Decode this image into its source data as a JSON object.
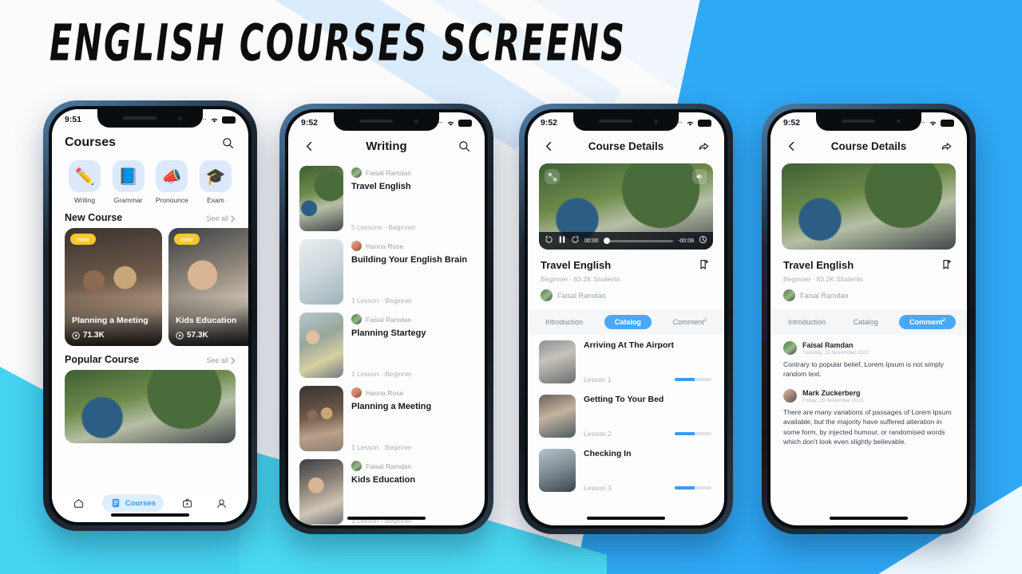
{
  "poster": {
    "title": "ENGLISH COURSES SCREENS"
  },
  "colors": {
    "accent": "#3a9bf0",
    "badge": "#ffc628",
    "bg_blue": "#2fa8f5",
    "bg_cyan": "#4ad9f3"
  },
  "screen1": {
    "status": {
      "time": "9:51"
    },
    "header": {
      "title": "Courses",
      "search_icon": "search-icon"
    },
    "categories": [
      {
        "label": "Writing",
        "icon": "pencil-icon",
        "glyph": "✏️"
      },
      {
        "label": "Grammar",
        "icon": "book-icon",
        "glyph": "📘"
      },
      {
        "label": "Pronounce",
        "icon": "megaphone-icon",
        "glyph": "📣"
      },
      {
        "label": "Exam",
        "icon": "graduation-cap-icon",
        "glyph": "🎓"
      }
    ],
    "new_course": {
      "title": "New Course",
      "see_all": "See all",
      "cards": [
        {
          "badge": "new",
          "title": "Planning a Meeting",
          "views": "71.3K"
        },
        {
          "badge": "new",
          "title": "Kids Education",
          "views": "57.3K"
        }
      ]
    },
    "popular_course": {
      "title": "Popular Course",
      "see_all": "See all"
    },
    "tabbar": [
      {
        "label": "",
        "icon": "home-icon",
        "active": false
      },
      {
        "label": "Courses",
        "icon": "document-icon",
        "active": true
      },
      {
        "label": "",
        "icon": "tv-play-icon",
        "active": false
      },
      {
        "label": "",
        "icon": "profile-icon",
        "active": false
      }
    ]
  },
  "screen2": {
    "status": {
      "time": "9:52"
    },
    "header": {
      "back_icon": "chevron-left-icon",
      "title": "Writing",
      "search_icon": "search-icon"
    },
    "items": [
      {
        "author": "Faisal Ramdan",
        "title": "Travel English",
        "meta": "5 Lessons  ·  Beginner",
        "thumb": "ph-camp",
        "avatar": "av-g"
      },
      {
        "author": "Hanna Rose",
        "title": "Building Your English Brain",
        "meta": "1 Lesson  ·  Beginner",
        "thumb": "ph-white",
        "avatar": "av-p"
      },
      {
        "author": "Faisal Ramdan",
        "title": "Planning Startegy",
        "meta": "1 Lesson  ·  Beginner",
        "thumb": "ph-board",
        "avatar": "av-g"
      },
      {
        "author": "Hanna Rose",
        "title": "Planning a Meeting",
        "meta": "1 Lesson  ·  Beginner",
        "thumb": "ph-meet",
        "avatar": "av-p"
      },
      {
        "author": "Faisal Ramdan",
        "title": "Kids Education",
        "meta": "1 Lesson  ·  Beginner",
        "thumb": "ph-kid",
        "avatar": "av-g"
      }
    ]
  },
  "screen3": {
    "status": {
      "time": "9:52"
    },
    "header": {
      "back_icon": "chevron-left-icon",
      "title": "Course Details",
      "share_icon": "share-icon"
    },
    "player": {
      "expand_icon": "expand-icon",
      "volume_icon": "volume-icon",
      "rewind_icon": "rewind-15-icon",
      "play_pause_icon": "pause-icon",
      "forward_icon": "forward-15-icon",
      "current_time": "00:00",
      "remaining_time": "-00:08",
      "airplay_icon": "airplay-icon",
      "progress_percent": 3
    },
    "course": {
      "title": "Travel English",
      "bookmark_icon": "bookmark-add-icon",
      "meta": "Beginner  ·  83.2K Students",
      "author": "Faisal Ramdan"
    },
    "tabs": [
      {
        "label": "Introduction",
        "active": false,
        "sup": ""
      },
      {
        "label": "Catalog",
        "active": true,
        "sup": ""
      },
      {
        "label": "Comment",
        "active": false,
        "sup": "2"
      }
    ],
    "lessons": [
      {
        "title": "Arriving At The Airport",
        "no": "Lesson 1",
        "progress": 55,
        "thumb": "ph-air"
      },
      {
        "title": "Getting To Your Bed",
        "no": "Lesson 2",
        "progress": 55,
        "thumb": "ph-bed"
      },
      {
        "title": "Checking In",
        "no": "Lesson 3",
        "progress": 55,
        "thumb": "ph-check"
      }
    ]
  },
  "screen4": {
    "status": {
      "time": "9:52"
    },
    "header": {
      "back_icon": "chevron-left-icon",
      "title": "Course Details",
      "share_icon": "share-icon"
    },
    "course": {
      "title": "Travel English",
      "bookmark_icon": "bookmark-add-icon",
      "meta": "Beginner  ·  83.2K Students",
      "author": "Faisal Ramdan"
    },
    "tabs": [
      {
        "label": "Introduction",
        "active": false,
        "sup": ""
      },
      {
        "label": "Catalog",
        "active": false,
        "sup": ""
      },
      {
        "label": "Comment",
        "active": true,
        "sup": "2"
      }
    ],
    "comments": [
      {
        "name": "Faisal Ramdan",
        "date": "Tuesday, 15 November 2022",
        "body": "Contrary to popular belief, Lorem Ipsum is not simply random text.",
        "avatar": "av-g"
      },
      {
        "name": "Mark Zuckerberg",
        "date": "Friday, 25 November 2022",
        "body": "There are many variations of passages of Lorem Ipsum available, but the majority have suffered alteration in some form, by injected humour, or randomised words which don't look even slightly believable.",
        "avatar": "av-b"
      }
    ]
  }
}
